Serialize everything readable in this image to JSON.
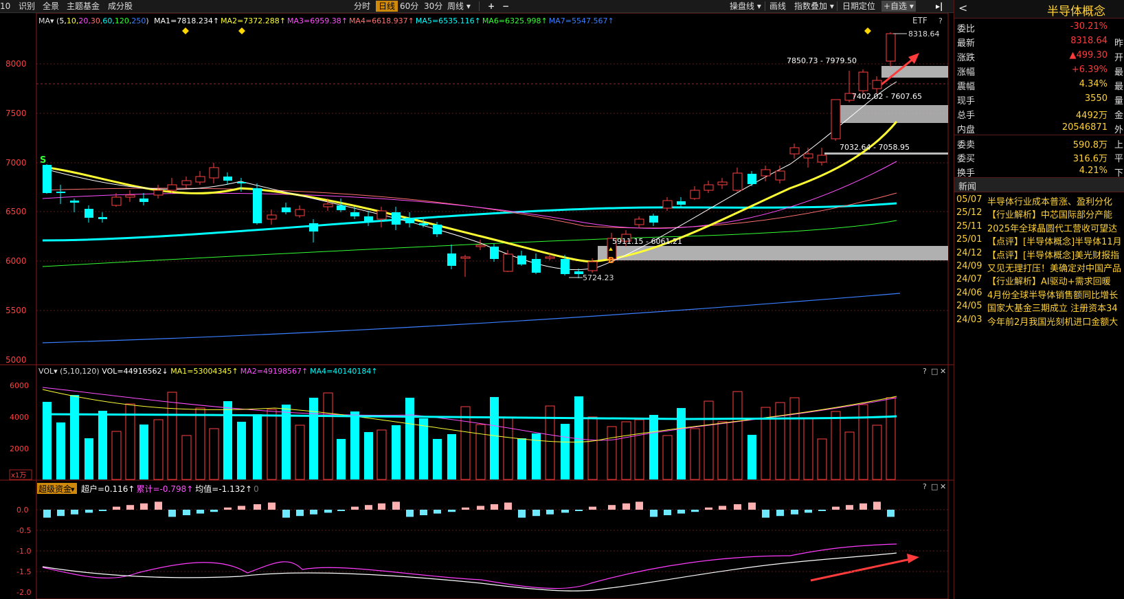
{
  "toolbar": {
    "left": [
      "10",
      "识别",
      "全景",
      "主题基金",
      "成分股"
    ],
    "periods": [
      "分时",
      "日线",
      "60分",
      "30分",
      "周线"
    ],
    "active_period": "日线",
    "plus": "+",
    "minus": "−",
    "right": [
      "操盘线",
      "画线",
      "指数叠加",
      "日期定位",
      "+自选"
    ]
  },
  "ma_legend": {
    "prefix": "MA",
    "params": [
      "5,",
      "10,",
      "20,",
      "30,",
      "60,",
      "120,",
      "250"
    ],
    "items": [
      "MA1=7818.234↑",
      "MA2=7372.288↑",
      "MA3=6959.38↑",
      "MA4=6618.937↑",
      "MA5=6535.116↑",
      "MA6=6325.998↑",
      "MA7=5547.567↑"
    ],
    "etf": "ETF",
    "help": "?"
  },
  "price_axis": [
    "8000",
    "7500",
    "7000",
    "6500",
    "6000",
    "5500",
    "5000"
  ],
  "annotations": {
    "high": "8318.64",
    "zone1": "7850.73 - 7979.50",
    "zone2": "7402.02 - 7607.65",
    "zone3": "7032.64 - 7058.95",
    "zone4": "5911.15 - 6061.21",
    "low": "5724.23",
    "sell": "S",
    "buy": "B"
  },
  "vol_legend": {
    "prefix": "VOL",
    "params": "(5,10,120)",
    "main": "VOL=44916562↓",
    "items": [
      "MA1=53004345↑",
      "MA2=49198567↑",
      "MA4=40140184↑"
    ],
    "axis": [
      "6000",
      "4000",
      "2000"
    ],
    "unit": "x1万"
  },
  "fund_legend": {
    "name": "超级资金",
    "items": [
      "超户=0.116↑",
      "累计=-0.798↑",
      "均值=-1.132↑",
      "0"
    ],
    "axis": [
      "0.0",
      "-0.5",
      "-1.0",
      "-1.5",
      "-2.0"
    ]
  },
  "panel_icons": [
    "?",
    "□",
    "✕"
  ],
  "side": {
    "back": "<",
    "title": "半导体概念",
    "quotes": [
      {
        "label": "委比",
        "value": "-30.21%",
        "color": "red",
        "next": ""
      },
      {
        "label": "最新",
        "value": "8318.64",
        "color": "red",
        "next": "昨"
      },
      {
        "label": "涨跌",
        "value": "▲499.30",
        "color": "red",
        "next": "开"
      },
      {
        "label": "涨幅",
        "value": "+6.39%",
        "color": "red",
        "next": "最"
      },
      {
        "label": "震幅",
        "value": "4.34%",
        "color": "yel",
        "next": "最"
      },
      {
        "label": "现手",
        "value": "3550",
        "color": "yel",
        "next": "量"
      },
      {
        "label": "总手",
        "value": "4492万",
        "color": "yel",
        "next": "金"
      },
      {
        "label": "内盘",
        "value": "20546871",
        "color": "yel",
        "next": "外"
      },
      {
        "label": "委卖",
        "value": "590.8万",
        "color": "yel",
        "next": "上"
      },
      {
        "label": "委买",
        "value": "316.6万",
        "color": "yel",
        "next": "平"
      },
      {
        "label": "换手",
        "value": "4.21%",
        "color": "yel",
        "next": "下"
      }
    ],
    "news_title": "新闻",
    "news": [
      {
        "date": "05/07",
        "text": "半导体行业成本普涨、盈利分化"
      },
      {
        "date": "25/12",
        "text": "【行业解析】中芯国际部分产能"
      },
      {
        "date": "25/11",
        "text": "2025年全球晶圆代工营收可望达"
      },
      {
        "date": "25/01",
        "text": "【点评】[半导体概念]半导体11月"
      },
      {
        "date": "24/12",
        "text": "【点评】[半导体概念]美光财报指"
      },
      {
        "date": "24/09",
        "text": "又见无理打压！美确定对中国产品"
      },
      {
        "date": "24/07",
        "text": "【行业解析】AI驱动+需求回暖"
      },
      {
        "date": "24/06",
        "text": "4月份全球半导体销售额同比增长"
      },
      {
        "date": "24/05",
        "text": "国家大基金三期成立 注册资本34"
      },
      {
        "date": "24/03",
        "text": "今年前2月我国光刻机进口金额大"
      }
    ]
  },
  "colors": {
    "up": "#ff4040",
    "down": "#00ffff",
    "ma_yellow": "#ffff33",
    "ma_white": "#ffffff",
    "accent": "#d08a0b"
  }
}
